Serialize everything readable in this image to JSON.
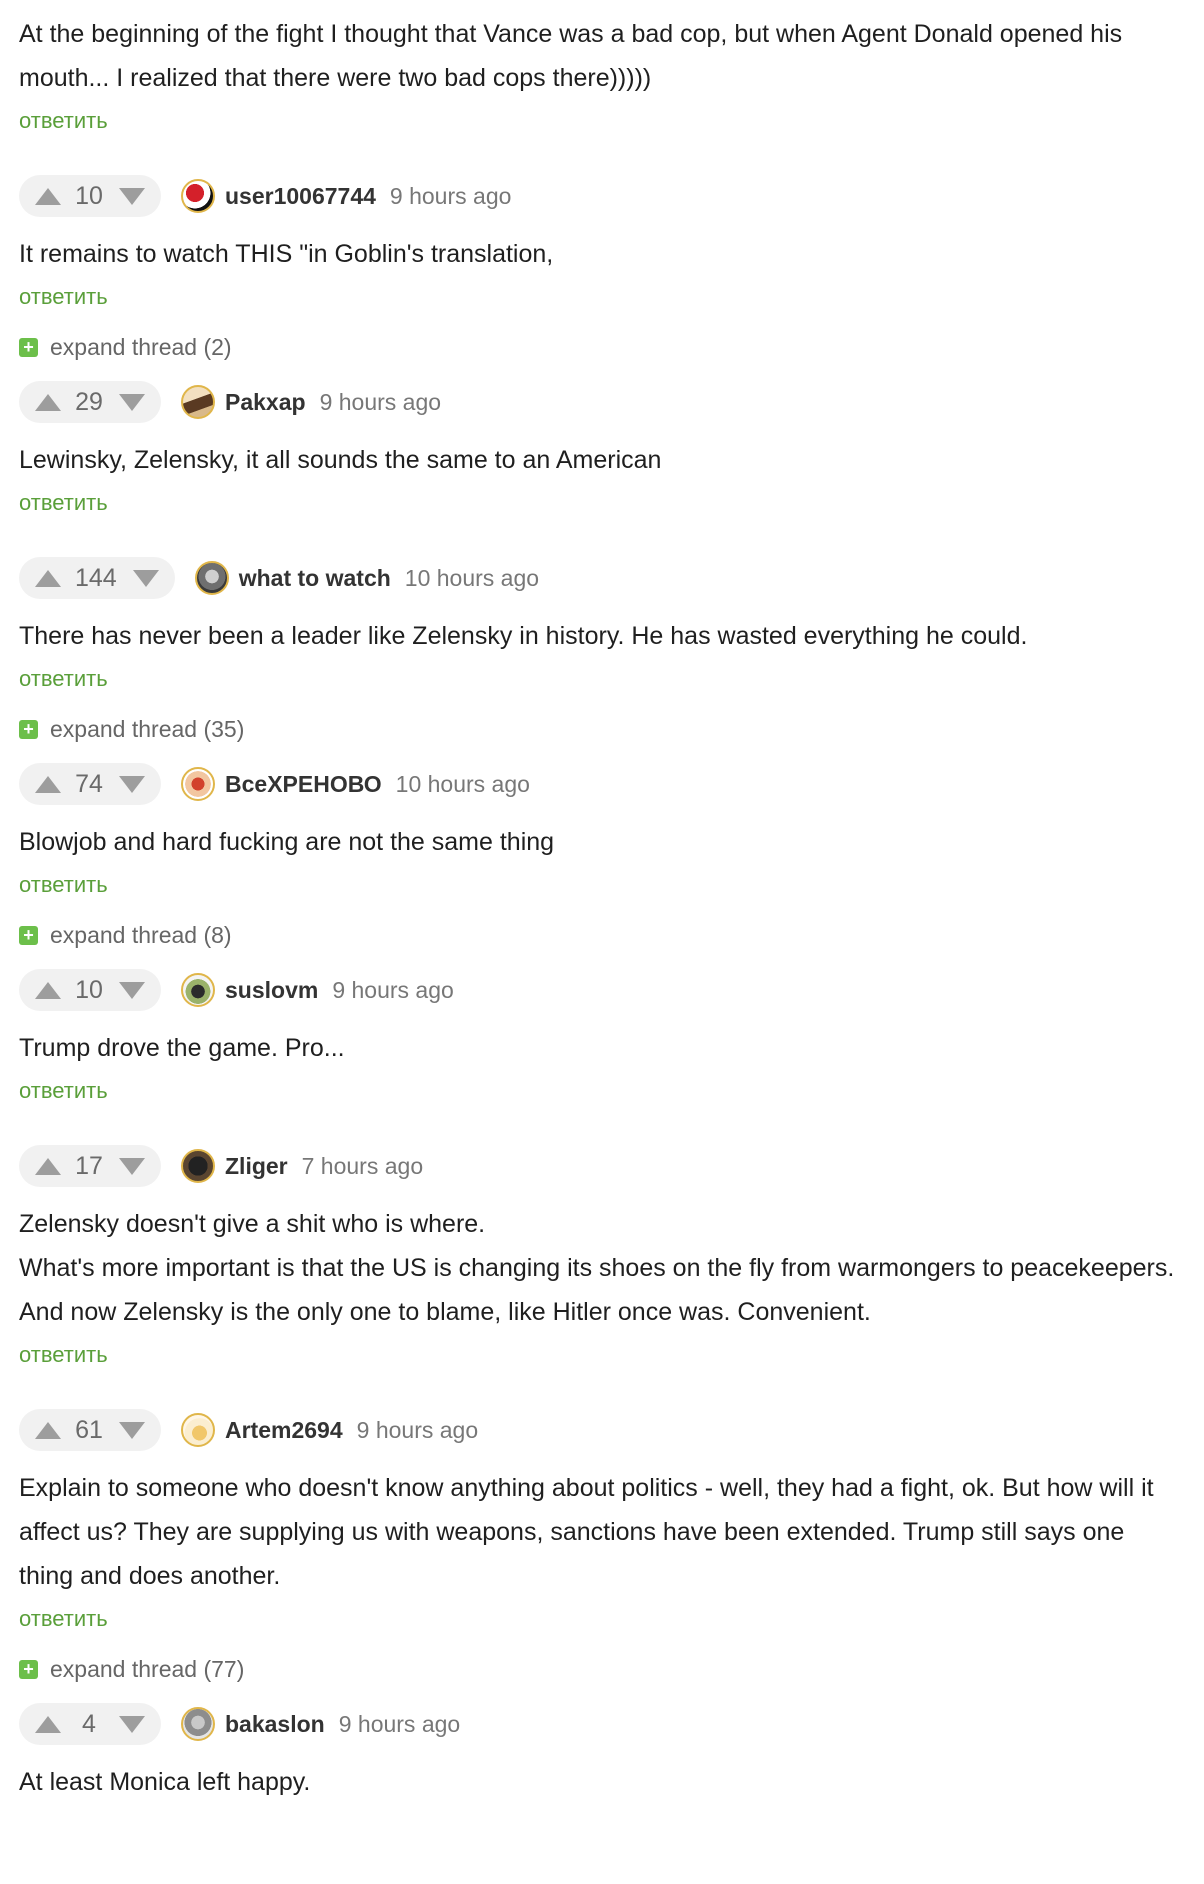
{
  "intro": {
    "text": "At the beginning of the fight I thought that Vance was a bad cop, but when Agent Donald opened his mouth... I realized that there were two bad cops there)))))",
    "reply_label": "ответить"
  },
  "comments": [
    {
      "votes": "10",
      "avatar_icon": "yin-yang-avatar-icon",
      "username": "user10067744",
      "time": "9 hours ago",
      "text": "It remains to watch THIS \"in Goblin's translation,",
      "reply_label": "ответить",
      "expand_thread": "expand thread (2)"
    },
    {
      "votes": "29",
      "avatar_icon": "pakxap-avatar-icon",
      "username": "Pakxap",
      "time": "9 hours ago",
      "text": "Lewinsky, Zelensky, it all sounds the same to an American",
      "reply_label": "ответить"
    },
    {
      "votes": "144",
      "avatar_icon": "what-to-watch-avatar-icon",
      "username": "what to watch",
      "time": "10 hours ago",
      "text": "There has never been a leader like Zelensky in history. He has wasted everything he could.",
      "reply_label": "ответить",
      "expand_thread": "expand thread (35)"
    },
    {
      "votes": "74",
      "avatar_icon": "vsekhrenovo-avatar-icon",
      "username": "ВсеХРЕНОВО",
      "time": "10 hours ago",
      "text": "Blowjob and hard fucking are not the same thing",
      "reply_label": "ответить",
      "expand_thread": "expand thread (8)"
    },
    {
      "votes": "10",
      "avatar_icon": "suslovm-avatar-icon",
      "username": "suslovm",
      "time": "9 hours ago",
      "text": "Trump drove the game. Pro...",
      "reply_label": "ответить"
    },
    {
      "votes": "17",
      "avatar_icon": "zliger-avatar-icon",
      "username": "Zliger",
      "time": "7 hours ago",
      "text_lines": [
        "Zelensky doesn't give a shit who is where.",
        "What's more important is that the US is changing its shoes on the fly from warmongers to peacekeepers.",
        "And now Zelensky is the only one to blame, like Hitler once was. Convenient."
      ],
      "reply_label": "ответить"
    },
    {
      "votes": "61",
      "avatar_icon": "artem2694-avatar-icon",
      "username": "Artem2694",
      "time": "9 hours ago",
      "text": "Explain to someone who doesn't know anything about politics - well, they had a fight, ok. But how will it affect us? They are supplying us with weapons, sanctions have been extended. Trump still says one thing and does another.",
      "reply_label": "ответить",
      "expand_thread": "expand thread (77)"
    },
    {
      "votes": "4",
      "avatar_icon": "bakaslon-avatar-icon",
      "username": "bakaslon",
      "time": "9 hours ago",
      "text": "At least Monica left happy."
    }
  ],
  "colors": {
    "reply_link": "#5a9f3a",
    "expand_plus": "#6cbf4a",
    "vote_bg": "#f1f1f1",
    "avatar_ring": "#e0b64a"
  }
}
